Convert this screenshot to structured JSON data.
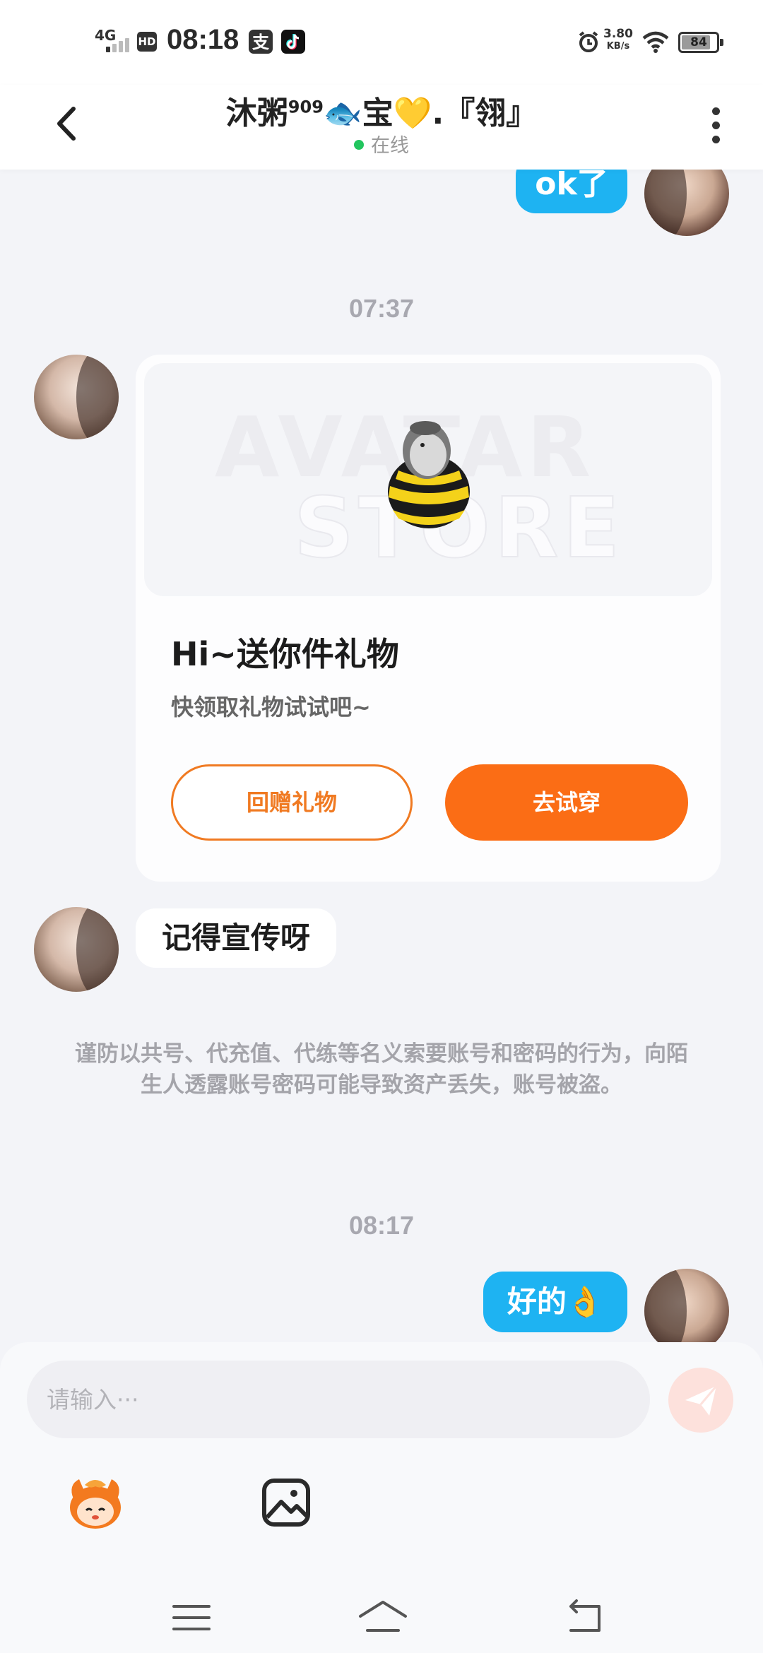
{
  "status_bar": {
    "network": "4G",
    "hd": "HD",
    "time": "08:18",
    "speed_value": "3.80",
    "speed_unit": "KB/s",
    "battery": "84",
    "battery_level": 0.84,
    "app_icons": [
      "alipay-icon",
      "tiktok-icon"
    ]
  },
  "header": {
    "title_part1": "沐粥",
    "title_sup": "909",
    "title_part2": "🐟宝💛.『翎』",
    "online_status": "在线"
  },
  "messages": {
    "top_me_text": "ok了",
    "time_1": "07:37",
    "gift": {
      "watermark_line1": "AVATAR",
      "watermark_line2": "STORE",
      "title": "Hi~送你件礼物",
      "subtitle": "快领取礼物试试吧~",
      "return_gift_label": "回赠礼物",
      "try_on_label": "去试穿"
    },
    "other_text": "记得宣传呀",
    "warning": "谨防以共号、代充值、代练等名义索要账号和密码的行为，向陌生人透露账号密码可能导致资产丢失，账号被盗。",
    "time_2": "08:17",
    "bottom_me_text": "好的👌"
  },
  "input": {
    "placeholder": "请输入···"
  },
  "colors": {
    "accent_orange": "#fb6d15",
    "bubble_blue": "#1eb3f2",
    "online_green": "#22c55e"
  }
}
